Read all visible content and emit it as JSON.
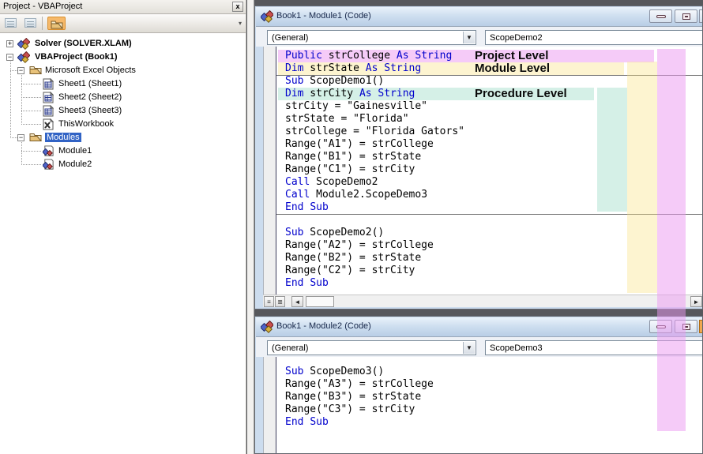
{
  "project_explorer": {
    "title": "Project - VBAProject",
    "toolbar": {
      "buttons": [
        "view-code",
        "view-object",
        "toggle-folders"
      ]
    },
    "tree": [
      {
        "label": "Solver (SOLVER.XLAM)",
        "icon": "vba-project",
        "level": 0,
        "expand": "+",
        "bold": true
      },
      {
        "label": "VBAProject (Book1)",
        "icon": "vba-project",
        "level": 0,
        "expand": "-",
        "bold": true
      },
      {
        "label": "Microsoft Excel Objects",
        "icon": "folder",
        "level": 1,
        "expand": "-"
      },
      {
        "label": "Sheet1 (Sheet1)",
        "icon": "worksheet",
        "level": 2
      },
      {
        "label": "Sheet2 (Sheet2)",
        "icon": "worksheet",
        "level": 2
      },
      {
        "label": "Sheet3 (Sheet3)",
        "icon": "worksheet",
        "level": 2
      },
      {
        "label": "ThisWorkbook",
        "icon": "workbook",
        "level": 2
      },
      {
        "label": "Modules",
        "icon": "folder",
        "level": 1,
        "expand": "-",
        "selected": true
      },
      {
        "label": "Module1",
        "icon": "module",
        "level": 2
      },
      {
        "label": "Module2",
        "icon": "module",
        "level": 2
      }
    ]
  },
  "module1_window": {
    "title": "Book1 - Module1 (Code)",
    "left_dropdown": "(General)",
    "right_dropdown": "ScopeDemo2",
    "code_lines": [
      "Public strCollege As String",
      "Dim strState As String",
      "Sub ScopeDemo1()",
      "Dim strCity As String",
      "strCity = \"Gainesville\"",
      "strState = \"Florida\"",
      "strCollege = \"Florida Gators\"",
      "Range(\"A1\") = strCollege",
      "Range(\"B1\") = strState",
      "Range(\"C1\") = strCity",
      "Call ScopeDemo2",
      "Call Module2.ScopeDemo3",
      "End Sub",
      "",
      "Sub ScopeDemo2()",
      "Range(\"A2\") = strCollege",
      "Range(\"B2\") = strState",
      "Range(\"C2\") = strCity",
      "End Sub"
    ],
    "separators_after": [
      1,
      12
    ],
    "row_highlights": {
      "0": "project",
      "1": "module",
      "3": "procedure"
    },
    "annotations": [
      {
        "line": 0,
        "text": "Project Level"
      },
      {
        "line": 1,
        "text": "Module Level"
      },
      {
        "line": 3,
        "text": "Procedure Level"
      }
    ]
  },
  "module2_window": {
    "title": "Book1 - Module2 (Code)",
    "left_dropdown": "(General)",
    "right_dropdown": "ScopeDemo3",
    "code_lines": [
      "Sub ScopeDemo3()",
      "Range(\"A3\") = strCollege",
      "Range(\"B3\") = strState",
      "Range(\"C3\") = strCity",
      "End Sub"
    ]
  },
  "scope_colors": {
    "project_level": "rgba(236,152,242,0.50)",
    "module_level": "rgba(250,227,132,0.38)",
    "procedure_level": "rgba(138,214,188,0.36)"
  },
  "syntax": {
    "keyword_color": "#0000cc",
    "keywords": [
      "Public",
      "Dim",
      "As",
      "String",
      "Sub",
      "End",
      "Call"
    ]
  }
}
